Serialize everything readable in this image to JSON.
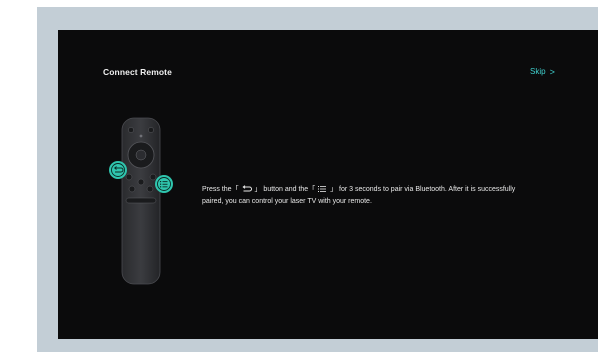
{
  "header": {
    "title": "Connect Remote",
    "skip_label": "Skip",
    "skip_chevron": ">"
  },
  "instructions": {
    "part1": "Press the「",
    "part2": "」 button and the「",
    "part3": "」 for 3 seconds to pair via Bluetooth. After it is successfully paired, you can control your laser TV with your remote."
  },
  "colors": {
    "accent": "#3fd1cf",
    "highlight": "#2fc5ae",
    "background": "#0b0b0c",
    "frame": "#c3ced6"
  },
  "icons": {
    "back_button": "back-icon",
    "menu_button": "menu-icon"
  }
}
